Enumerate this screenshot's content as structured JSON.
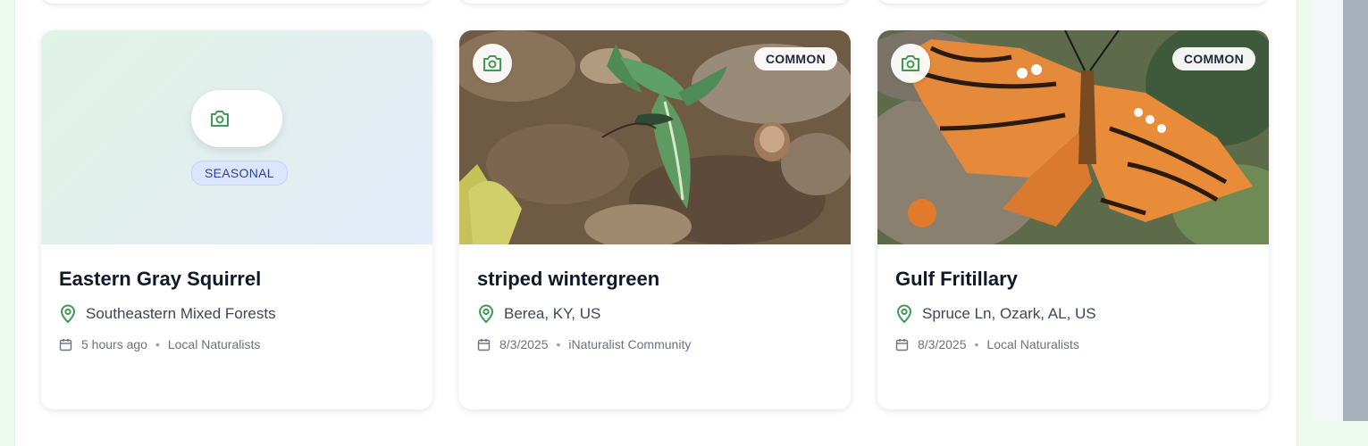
{
  "colors": {
    "accent_green": "#3f9a55",
    "seasonal_bg": "#dbe5fb",
    "seasonal_text": "#2b3f9e"
  },
  "cards": [
    {
      "title": "Eastern Gray Squirrel",
      "location": "Southeastern Mixed Forests",
      "date": "5 hours ago",
      "source": "Local Naturalists",
      "rarity": "SEASONAL",
      "has_photo": false,
      "icons": [
        "camera-icon",
        "map-pin-icon",
        "calendar-icon"
      ]
    },
    {
      "title": "striped wintergreen",
      "location": "Berea, KY, US",
      "date": "8/3/2025",
      "source": "iNaturalist Community",
      "rarity": "COMMON",
      "has_photo": true,
      "icons": [
        "camera-icon",
        "map-pin-icon",
        "calendar-icon"
      ]
    },
    {
      "title": "Gulf Fritillary",
      "location": "Spruce Ln, Ozark, AL, US",
      "date": "8/3/2025",
      "source": "Local Naturalists",
      "rarity": "COMMON",
      "has_photo": true,
      "icons": [
        "camera-icon",
        "map-pin-icon",
        "calendar-icon"
      ]
    }
  ],
  "separator": "•"
}
